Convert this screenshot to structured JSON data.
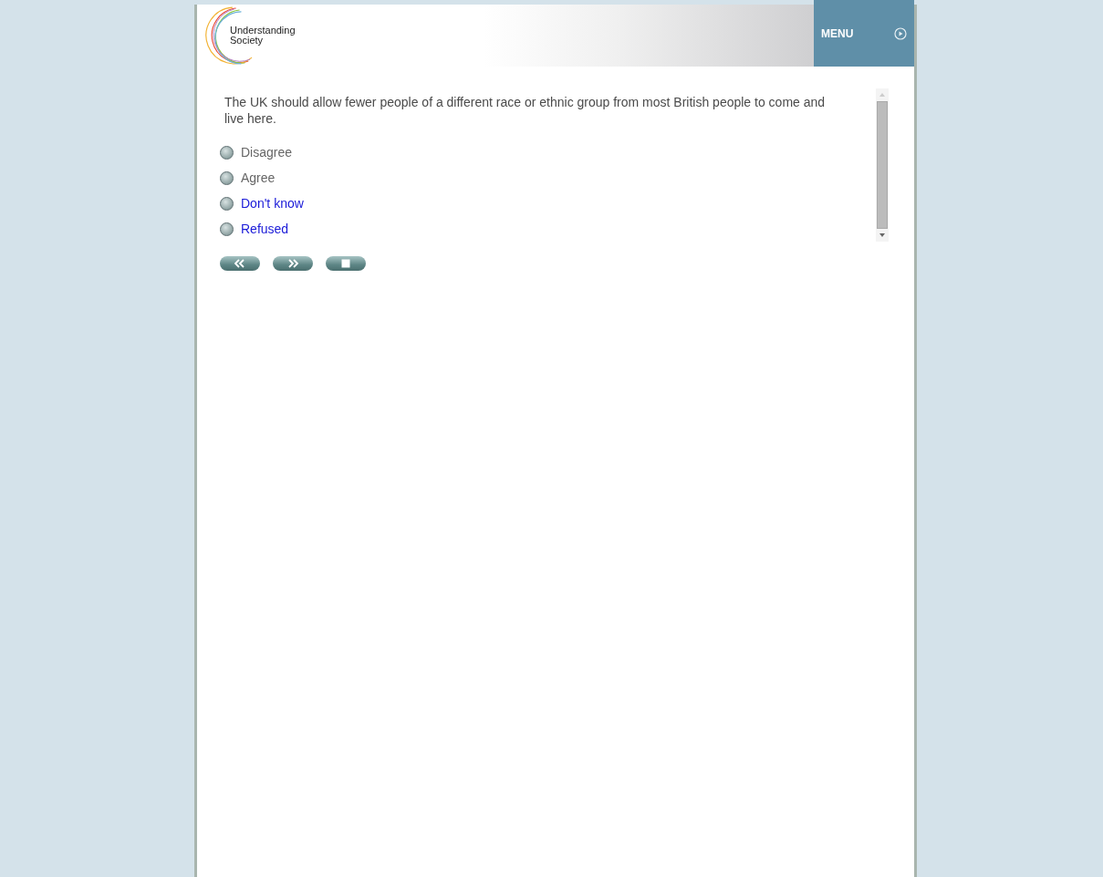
{
  "header": {
    "logo_text": "Understanding Society",
    "menu_label": "MENU"
  },
  "question": {
    "text": "The UK should allow fewer people of a different race or ethnic group from most British people to come and live here.",
    "options": [
      {
        "label": "Disagree",
        "kind": "answer",
        "selected": false
      },
      {
        "label": "Agree",
        "kind": "answer",
        "selected": false
      },
      {
        "label": "Don't know",
        "kind": "special",
        "selected": false
      },
      {
        "label": "Refused",
        "kind": "special",
        "selected": false
      }
    ]
  },
  "nav_buttons": [
    {
      "kind": "back"
    },
    {
      "kind": "next"
    },
    {
      "kind": "stop"
    }
  ]
}
